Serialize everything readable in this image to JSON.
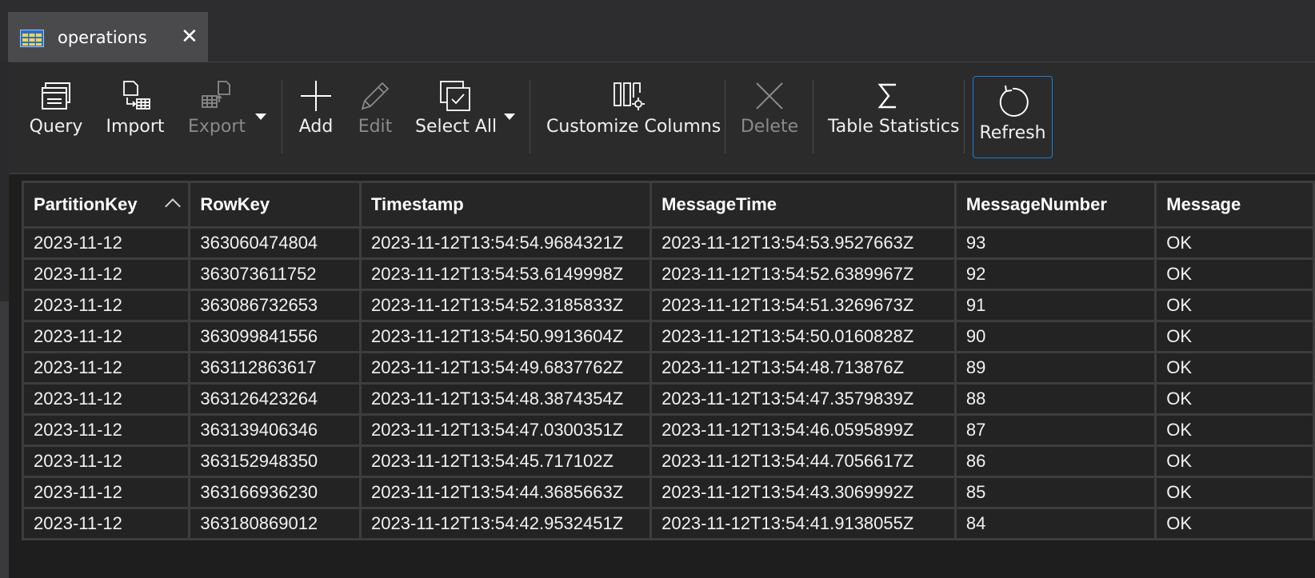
{
  "tab": {
    "title": "operations",
    "close": "✕"
  },
  "toolbar": {
    "query": "Query",
    "import": "Import",
    "export": "Export",
    "add": "Add",
    "edit": "Edit",
    "select_all": "Select All",
    "customize_columns": "Customize Columns",
    "delete": "Delete",
    "table_statistics": "Table Statistics",
    "refresh": "Refresh"
  },
  "grid": {
    "columns": [
      "PartitionKey",
      "RowKey",
      "Timestamp",
      "MessageTime",
      "MessageNumber",
      "Message"
    ],
    "sorted_column": "PartitionKey",
    "sort_direction": "ascending",
    "rows": [
      [
        "2023-11-12",
        "363060474804",
        "2023-11-12T13:54:54.9684321Z",
        "2023-11-12T13:54:53.9527663Z",
        "93",
        "OK"
      ],
      [
        "2023-11-12",
        "363073611752",
        "2023-11-12T13:54:53.6149998Z",
        "2023-11-12T13:54:52.6389967Z",
        "92",
        "OK"
      ],
      [
        "2023-11-12",
        "363086732653",
        "2023-11-12T13:54:52.3185833Z",
        "2023-11-12T13:54:51.3269673Z",
        "91",
        "OK"
      ],
      [
        "2023-11-12",
        "363099841556",
        "2023-11-12T13:54:50.9913604Z",
        "2023-11-12T13:54:50.0160828Z",
        "90",
        "OK"
      ],
      [
        "2023-11-12",
        "363112863617",
        "2023-11-12T13:54:49.6837762Z",
        "2023-11-12T13:54:48.713876Z",
        "89",
        "OK"
      ],
      [
        "2023-11-12",
        "363126423264",
        "2023-11-12T13:54:48.3874354Z",
        "2023-11-12T13:54:47.3579839Z",
        "88",
        "OK"
      ],
      [
        "2023-11-12",
        "363139406346",
        "2023-11-12T13:54:47.0300351Z",
        "2023-11-12T13:54:46.0595899Z",
        "87",
        "OK"
      ],
      [
        "2023-11-12",
        "363152948350",
        "2023-11-12T13:54:45.717102Z",
        "2023-11-12T13:54:44.7056617Z",
        "86",
        "OK"
      ],
      [
        "2023-11-12",
        "363166936230",
        "2023-11-12T13:54:44.3685663Z",
        "2023-11-12T13:54:43.3069992Z",
        "85",
        "OK"
      ],
      [
        "2023-11-12",
        "363180869012",
        "2023-11-12T13:54:42.9532451Z",
        "2023-11-12T13:54:41.9138055Z",
        "84",
        "OK"
      ]
    ]
  },
  "colors": {
    "accent": "#1c7fd6",
    "background": "#1e1e1e",
    "grid_border": "#3d3d3d"
  }
}
